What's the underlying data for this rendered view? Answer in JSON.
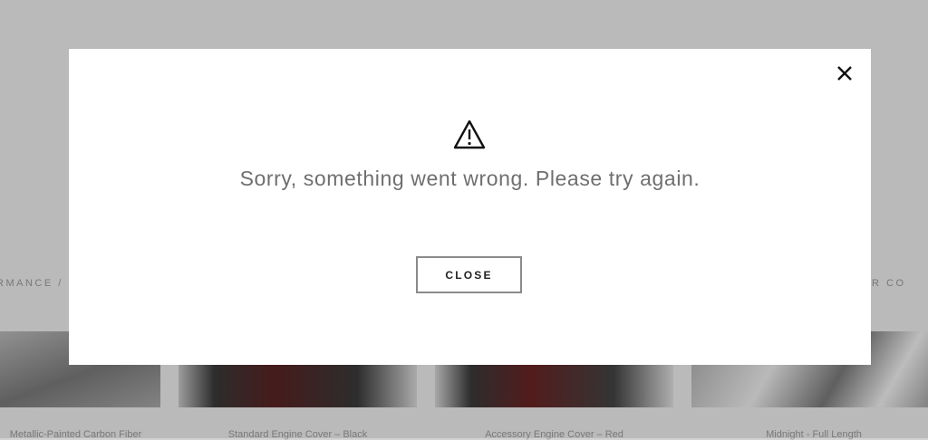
{
  "background": {
    "breadcrumb_left": "RMANCE /",
    "breadcrumb_right": "RIOR CO",
    "cards": [
      {
        "name": "Metallic-Painted Carbon Fiber"
      },
      {
        "name": "Standard Engine Cover – Black"
      },
      {
        "name": "Accessory Engine Cover – Red"
      },
      {
        "name": "Midnight - Full Length"
      }
    ]
  },
  "modal": {
    "message": "Sorry, something went wrong. Please try again.",
    "close_button_label": "CLOSE",
    "close_icon": "close-icon",
    "warning_icon": "warning-triangle-icon"
  }
}
